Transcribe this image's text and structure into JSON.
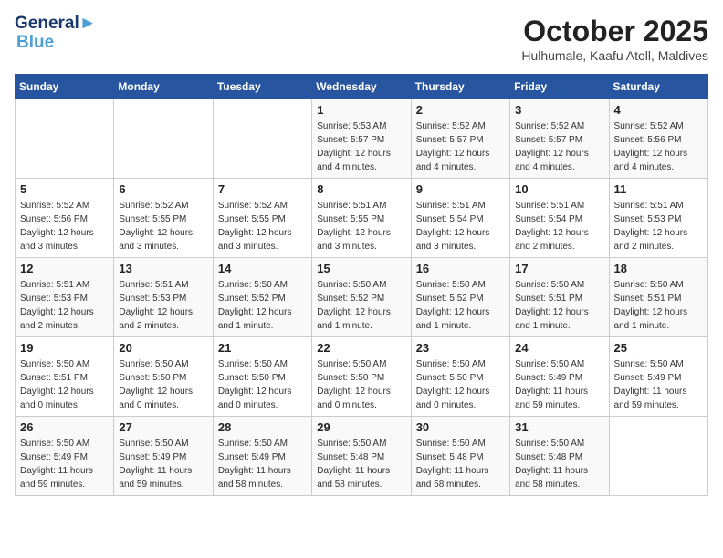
{
  "header": {
    "logo_line1": "General",
    "logo_line2": "Blue",
    "month": "October 2025",
    "location": "Hulhumale, Kaafu Atoll, Maldives"
  },
  "days_of_week": [
    "Sunday",
    "Monday",
    "Tuesday",
    "Wednesday",
    "Thursday",
    "Friday",
    "Saturday"
  ],
  "weeks": [
    [
      {
        "day": "",
        "info": ""
      },
      {
        "day": "",
        "info": ""
      },
      {
        "day": "",
        "info": ""
      },
      {
        "day": "1",
        "info": "Sunrise: 5:53 AM\nSunset: 5:57 PM\nDaylight: 12 hours and 4 minutes."
      },
      {
        "day": "2",
        "info": "Sunrise: 5:52 AM\nSunset: 5:57 PM\nDaylight: 12 hours and 4 minutes."
      },
      {
        "day": "3",
        "info": "Sunrise: 5:52 AM\nSunset: 5:57 PM\nDaylight: 12 hours and 4 minutes."
      },
      {
        "day": "4",
        "info": "Sunrise: 5:52 AM\nSunset: 5:56 PM\nDaylight: 12 hours and 4 minutes."
      }
    ],
    [
      {
        "day": "5",
        "info": "Sunrise: 5:52 AM\nSunset: 5:56 PM\nDaylight: 12 hours and 3 minutes."
      },
      {
        "day": "6",
        "info": "Sunrise: 5:52 AM\nSunset: 5:55 PM\nDaylight: 12 hours and 3 minutes."
      },
      {
        "day": "7",
        "info": "Sunrise: 5:52 AM\nSunset: 5:55 PM\nDaylight: 12 hours and 3 minutes."
      },
      {
        "day": "8",
        "info": "Sunrise: 5:51 AM\nSunset: 5:55 PM\nDaylight: 12 hours and 3 minutes."
      },
      {
        "day": "9",
        "info": "Sunrise: 5:51 AM\nSunset: 5:54 PM\nDaylight: 12 hours and 3 minutes."
      },
      {
        "day": "10",
        "info": "Sunrise: 5:51 AM\nSunset: 5:54 PM\nDaylight: 12 hours and 2 minutes."
      },
      {
        "day": "11",
        "info": "Sunrise: 5:51 AM\nSunset: 5:53 PM\nDaylight: 12 hours and 2 minutes."
      }
    ],
    [
      {
        "day": "12",
        "info": "Sunrise: 5:51 AM\nSunset: 5:53 PM\nDaylight: 12 hours and 2 minutes."
      },
      {
        "day": "13",
        "info": "Sunrise: 5:51 AM\nSunset: 5:53 PM\nDaylight: 12 hours and 2 minutes."
      },
      {
        "day": "14",
        "info": "Sunrise: 5:50 AM\nSunset: 5:52 PM\nDaylight: 12 hours and 1 minute."
      },
      {
        "day": "15",
        "info": "Sunrise: 5:50 AM\nSunset: 5:52 PM\nDaylight: 12 hours and 1 minute."
      },
      {
        "day": "16",
        "info": "Sunrise: 5:50 AM\nSunset: 5:52 PM\nDaylight: 12 hours and 1 minute."
      },
      {
        "day": "17",
        "info": "Sunrise: 5:50 AM\nSunset: 5:51 PM\nDaylight: 12 hours and 1 minute."
      },
      {
        "day": "18",
        "info": "Sunrise: 5:50 AM\nSunset: 5:51 PM\nDaylight: 12 hours and 1 minute."
      }
    ],
    [
      {
        "day": "19",
        "info": "Sunrise: 5:50 AM\nSunset: 5:51 PM\nDaylight: 12 hours and 0 minutes."
      },
      {
        "day": "20",
        "info": "Sunrise: 5:50 AM\nSunset: 5:50 PM\nDaylight: 12 hours and 0 minutes."
      },
      {
        "day": "21",
        "info": "Sunrise: 5:50 AM\nSunset: 5:50 PM\nDaylight: 12 hours and 0 minutes."
      },
      {
        "day": "22",
        "info": "Sunrise: 5:50 AM\nSunset: 5:50 PM\nDaylight: 12 hours and 0 minutes."
      },
      {
        "day": "23",
        "info": "Sunrise: 5:50 AM\nSunset: 5:50 PM\nDaylight: 12 hours and 0 minutes."
      },
      {
        "day": "24",
        "info": "Sunrise: 5:50 AM\nSunset: 5:49 PM\nDaylight: 11 hours and 59 minutes."
      },
      {
        "day": "25",
        "info": "Sunrise: 5:50 AM\nSunset: 5:49 PM\nDaylight: 11 hours and 59 minutes."
      }
    ],
    [
      {
        "day": "26",
        "info": "Sunrise: 5:50 AM\nSunset: 5:49 PM\nDaylight: 11 hours and 59 minutes."
      },
      {
        "day": "27",
        "info": "Sunrise: 5:50 AM\nSunset: 5:49 PM\nDaylight: 11 hours and 59 minutes."
      },
      {
        "day": "28",
        "info": "Sunrise: 5:50 AM\nSunset: 5:49 PM\nDaylight: 11 hours and 58 minutes."
      },
      {
        "day": "29",
        "info": "Sunrise: 5:50 AM\nSunset: 5:48 PM\nDaylight: 11 hours and 58 minutes."
      },
      {
        "day": "30",
        "info": "Sunrise: 5:50 AM\nSunset: 5:48 PM\nDaylight: 11 hours and 58 minutes."
      },
      {
        "day": "31",
        "info": "Sunrise: 5:50 AM\nSunset: 5:48 PM\nDaylight: 11 hours and 58 minutes."
      },
      {
        "day": "",
        "info": ""
      }
    ]
  ]
}
